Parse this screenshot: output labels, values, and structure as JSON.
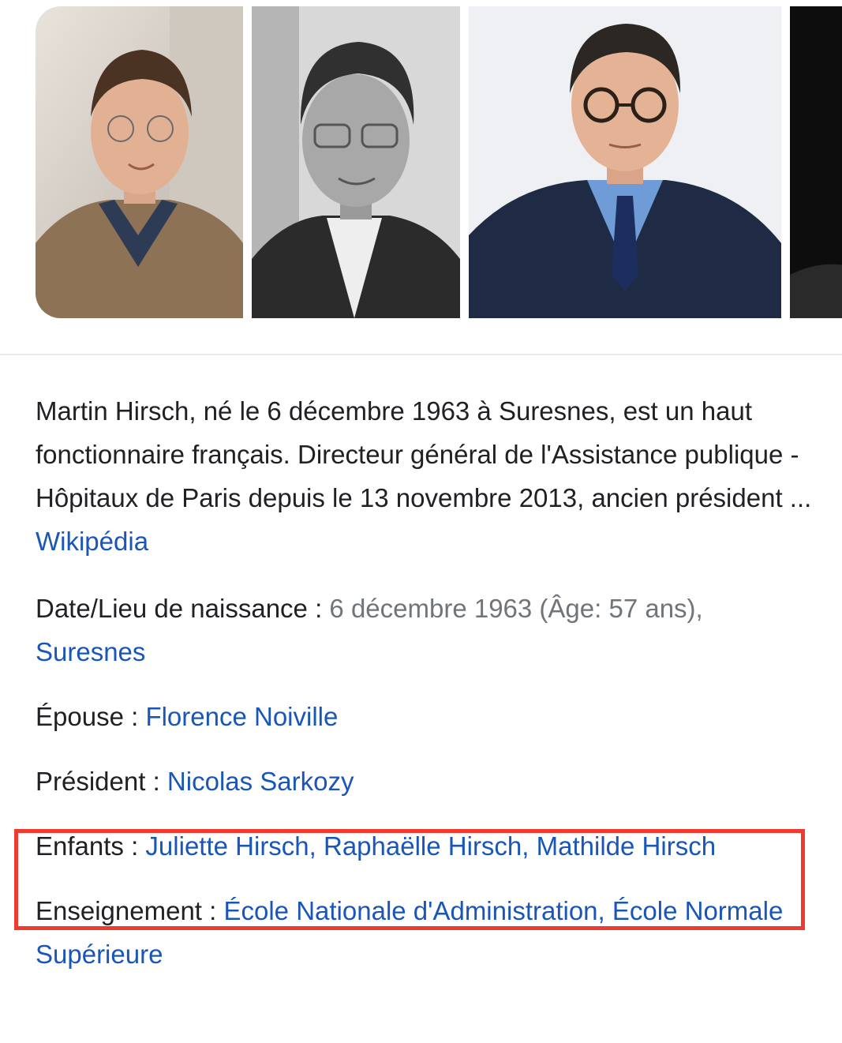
{
  "photos": [
    {
      "name": "photo-1"
    },
    {
      "name": "photo-2"
    },
    {
      "name": "photo-3"
    },
    {
      "name": "photo-4"
    }
  ],
  "description": {
    "text": "Martin Hirsch, né le 6 décembre 1963 à Suresnes, est un haut fonctionnaire français. Directeur général de l'Assistance publique - Hôpitaux de Paris depuis le 13 novembre 2013, ancien président ... ",
    "source_link": "Wikipédia"
  },
  "facts": {
    "birth": {
      "label": "Date/Lieu de naissance : ",
      "value": "6 décembre 1963 (Âge: 57 ans), ",
      "link": "Suresnes"
    },
    "spouse": {
      "label": "Épouse : ",
      "link": "Florence Noiville"
    },
    "president": {
      "label": "Président : ",
      "link": "Nicolas Sarkozy"
    },
    "children": {
      "label": "Enfants : ",
      "links": [
        "Juliette Hirsch",
        "Raphaëlle Hirsch",
        "Mathilde Hirsch"
      ],
      "separator": ", "
    },
    "education": {
      "label": "Enseignement : ",
      "links": [
        "École Nationale d'Administration",
        "École Normale Supérieure"
      ],
      "separator": ", "
    }
  },
  "colors": {
    "link": "#1a56b8",
    "highlight_border": "#ef3a2f",
    "secondary_text": "#70757a"
  }
}
